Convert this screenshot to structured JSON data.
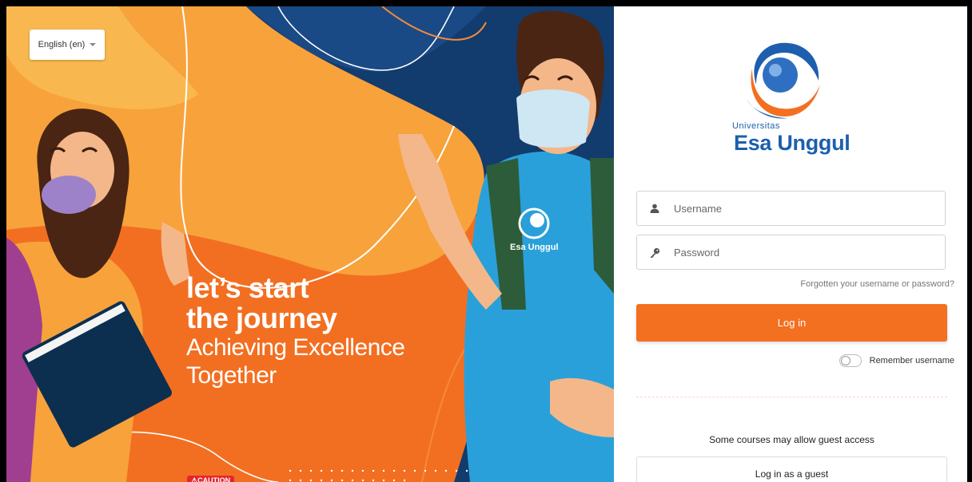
{
  "language": {
    "selected": "English (en)"
  },
  "hero": {
    "slogan_line1": "let’s start",
    "slogan_line2": "the journey",
    "slogan_line3": "Achieving Excellence",
    "slogan_line4": "Together",
    "shirt_logo": "Esa Unggul",
    "caution": "⚠CAUTION"
  },
  "brand": {
    "small": "Universitas",
    "big": "Esa Unggul"
  },
  "form": {
    "username_placeholder": "Username",
    "password_placeholder": "Password",
    "forgot_link": "Forgotten your username or password?",
    "login_button": "Log in",
    "remember_label": "Remember username",
    "guest_text": "Some courses may allow guest access",
    "guest_button": "Log in as a guest"
  },
  "colors": {
    "accent": "#f37021",
    "brand_blue": "#1c5fae",
    "hero_orange": "#f26f21",
    "hero_navy": "#123b6e"
  },
  "icons": [
    "chevron-down-icon",
    "user-icon",
    "key-icon",
    "university-logo"
  ]
}
